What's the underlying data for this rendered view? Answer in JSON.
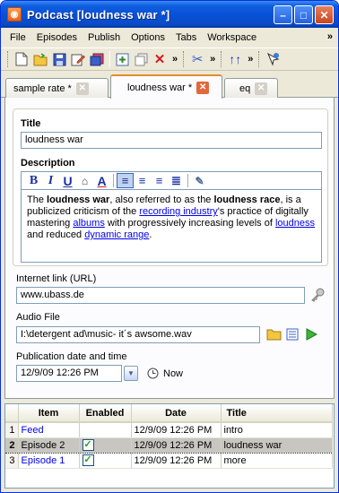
{
  "window": {
    "title": "Podcast [loudness war *]"
  },
  "menu": {
    "items": [
      "File",
      "Episodes",
      "Publish",
      "Options",
      "Tabs",
      "Workspace"
    ],
    "overflow": "»"
  },
  "toolbar": {
    "more1": "»",
    "more2": "»",
    "more3": "»"
  },
  "tabs": [
    {
      "label": "sample rate *"
    },
    {
      "label": "loudness war *"
    },
    {
      "label": "eq"
    }
  ],
  "form": {
    "title_label": "Title",
    "title_value": "loudness war",
    "description_label": "Description",
    "description": {
      "p1": "The ",
      "b1": "loudness war",
      "p2": ", also referred to as the ",
      "b2": "loudness race",
      "p3": ", is a publicized criticism of the ",
      "l1": "recording industry",
      "p4": "'s practice of digitally mastering ",
      "l2": "albums",
      "p5": " with progressively increasing levels of ",
      "l3": "loudness",
      "p6": " and reduced ",
      "l4": "dynamic range",
      "p7": "."
    },
    "link_label": "Internet link (URL)",
    "link_value": "www.ubass.de",
    "audio_label": "Audio File",
    "audio_value": "I:\\detergent ad\\music- it´s awsome.wav",
    "pubdate_label": "Publication date and time",
    "pubdate_value": "12/9/09 12:26 PM",
    "now_label": "Now"
  },
  "episodes": {
    "headers": [
      "Item",
      "Enabled",
      "Date",
      "Title"
    ],
    "rows": [
      {
        "num": "1",
        "item": "Feed",
        "enabled": "",
        "date": "12/9/09 12:26 PM",
        "title": "intro"
      },
      {
        "num": "2",
        "item": "Episode 2",
        "enabled": "✓",
        "date": "12/9/09 12:26 PM",
        "title": "loudness war"
      },
      {
        "num": "3",
        "item": "Episode 1",
        "enabled": "✓",
        "date": "12/9/09 12:26 PM",
        "title": "more"
      }
    ]
  },
  "colors": {
    "titlebar": "#0850d6",
    "link": "#0000ee",
    "active_tab_accent": "#e68b2c",
    "tab_close_active": "#e2673a"
  }
}
